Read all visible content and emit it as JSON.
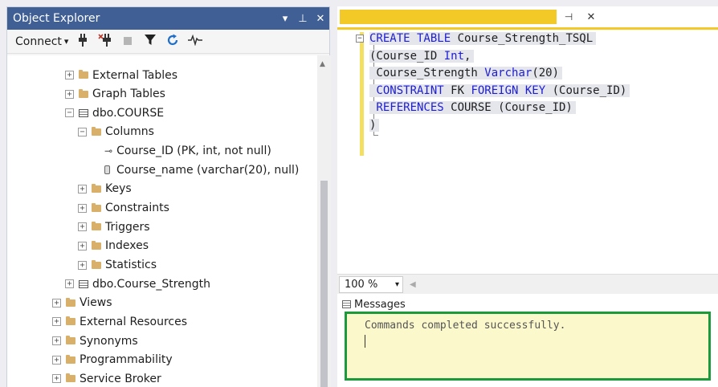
{
  "object_explorer": {
    "title": "Object Explorer",
    "title_buttons": {
      "dropdown": "▾",
      "pin": "⊥",
      "close": "✕"
    },
    "toolbar": {
      "connect_label": "Connect",
      "connect_arrow": "▾"
    },
    "tree": [
      {
        "label": "External Tables",
        "expander": "+",
        "icon": "folder-icon"
      },
      {
        "label": "Graph Tables",
        "expander": "+",
        "icon": "folder-icon"
      },
      {
        "label": "dbo.COURSE",
        "expander": "−",
        "icon": "table-icon"
      },
      {
        "label": "Columns",
        "expander": "−",
        "icon": "folder-icon"
      },
      {
        "label": "Course_ID (PK, int, not null)",
        "expander": "",
        "icon": "key-icon"
      },
      {
        "label": "Course_name (varchar(20), null)",
        "expander": "",
        "icon": "column-icon"
      },
      {
        "label": "Keys",
        "expander": "+",
        "icon": "folder-icon"
      },
      {
        "label": "Constraints",
        "expander": "+",
        "icon": "folder-icon"
      },
      {
        "label": "Triggers",
        "expander": "+",
        "icon": "folder-icon"
      },
      {
        "label": "Indexes",
        "expander": "+",
        "icon": "folder-icon"
      },
      {
        "label": "Statistics",
        "expander": "+",
        "icon": "folder-icon"
      },
      {
        "label": "dbo.Course_Strength",
        "expander": "+",
        "icon": "table-icon"
      },
      {
        "label": "Views",
        "expander": "+",
        "icon": "folder-icon"
      },
      {
        "label": "External Resources",
        "expander": "+",
        "icon": "folder-icon"
      },
      {
        "label": "Synonyms",
        "expander": "+",
        "icon": "folder-icon"
      },
      {
        "label": "Programmability",
        "expander": "+",
        "icon": "folder-icon"
      },
      {
        "label": "Service Broker",
        "expander": "+",
        "icon": "folder-icon"
      }
    ]
  },
  "editor": {
    "tab": {
      "pin": "⊣",
      "close": "✕"
    },
    "collapse_marker": "−",
    "code_lines": [
      [
        {
          "t": "CREATE TABLE",
          "k": true
        },
        {
          "t": " Course_Strength_TSQL",
          "k": false
        }
      ],
      [
        {
          "t": "(Course_ID ",
          "k": false
        },
        {
          "t": "Int",
          "k": true
        },
        {
          "t": ",",
          "k": false
        }
      ],
      [
        {
          "t": " Course_Strength ",
          "k": false
        },
        {
          "t": "Varchar",
          "k": true
        },
        {
          "t": "(20)",
          "k": false
        }
      ],
      [
        {
          "t": " CONSTRAINT",
          "k": true
        },
        {
          "t": " FK ",
          "k": false
        },
        {
          "t": "FOREIGN KEY",
          "k": true
        },
        {
          "t": " (Course_ID)",
          "k": false
        }
      ],
      [
        {
          "t": " REFERENCES",
          "k": true
        },
        {
          "t": " COURSE (Course_ID)",
          "k": false
        }
      ],
      [
        {
          "t": ")",
          "k": false
        }
      ]
    ],
    "zoom": {
      "value": "100 %",
      "arrow": "▾",
      "scroll_left": "◀"
    }
  },
  "messages": {
    "tab_label": "Messages",
    "text": "Commands completed successfully."
  },
  "colors": {
    "title_bar": "#3f5f95",
    "tab_accent": "#f3c928",
    "keyword": "#1d1dd6",
    "success_border": "#1a9a3c",
    "message_bg": "#fbf8cc"
  }
}
